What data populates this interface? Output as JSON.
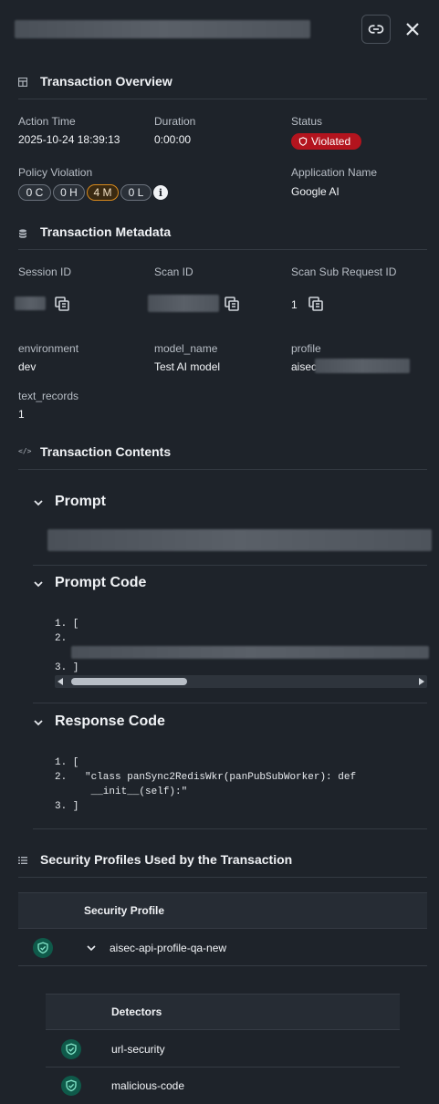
{
  "header": {
    "title_redacted": true,
    "link_icon": "link-icon",
    "close_icon": "close-icon"
  },
  "overview": {
    "title": "Transaction Overview",
    "action_time_label": "Action Time",
    "action_time": "2025-10-24 18:39:13",
    "duration_label": "Duration",
    "duration": "0:00:00",
    "status_label": "Status",
    "status": "Violated",
    "policy_label": "Policy Violation",
    "pills": [
      "0 C",
      "0 H",
      "4 M",
      "0 L"
    ],
    "app_label": "Application Name",
    "app_name": "Google AI"
  },
  "metadata": {
    "title": "Transaction Metadata",
    "session_label": "Session ID",
    "scan_label": "Scan ID",
    "sub_label": "Scan Sub Request ID",
    "sub_value": "1",
    "env_label": "environment",
    "env_value": "dev",
    "model_label": "model_name",
    "model_value": "Test AI model",
    "profile_label": "profile",
    "profile_value": "aisec",
    "text_label": "text_records",
    "text_value": "1"
  },
  "contents": {
    "title": "Transaction Contents",
    "prompt_title": "Prompt",
    "prompt_code_title": "Prompt Code",
    "prompt_code": {
      "l1": "1. [",
      "l2": "2.",
      "l3": "3. ]"
    },
    "response_title": "Response Code",
    "response_code": {
      "l1": "1. [",
      "l2": "2.   \"class panSync2RedisWkr(panPubSubWorker): def",
      "l2b": "      __init__(self):\"",
      "l3": "3. ]"
    }
  },
  "profiles": {
    "title": "Security Profiles Used by the Transaction",
    "col_header": "Security Profile",
    "profile_name": "aisec-api-profile-qa-new",
    "detectors_header": "Detectors",
    "detectors": [
      "url-security",
      "malicious-code"
    ]
  },
  "colors": {
    "violated": "#b3141e",
    "medium": "#d7891c",
    "ok_shield": "#0f5a4a"
  }
}
